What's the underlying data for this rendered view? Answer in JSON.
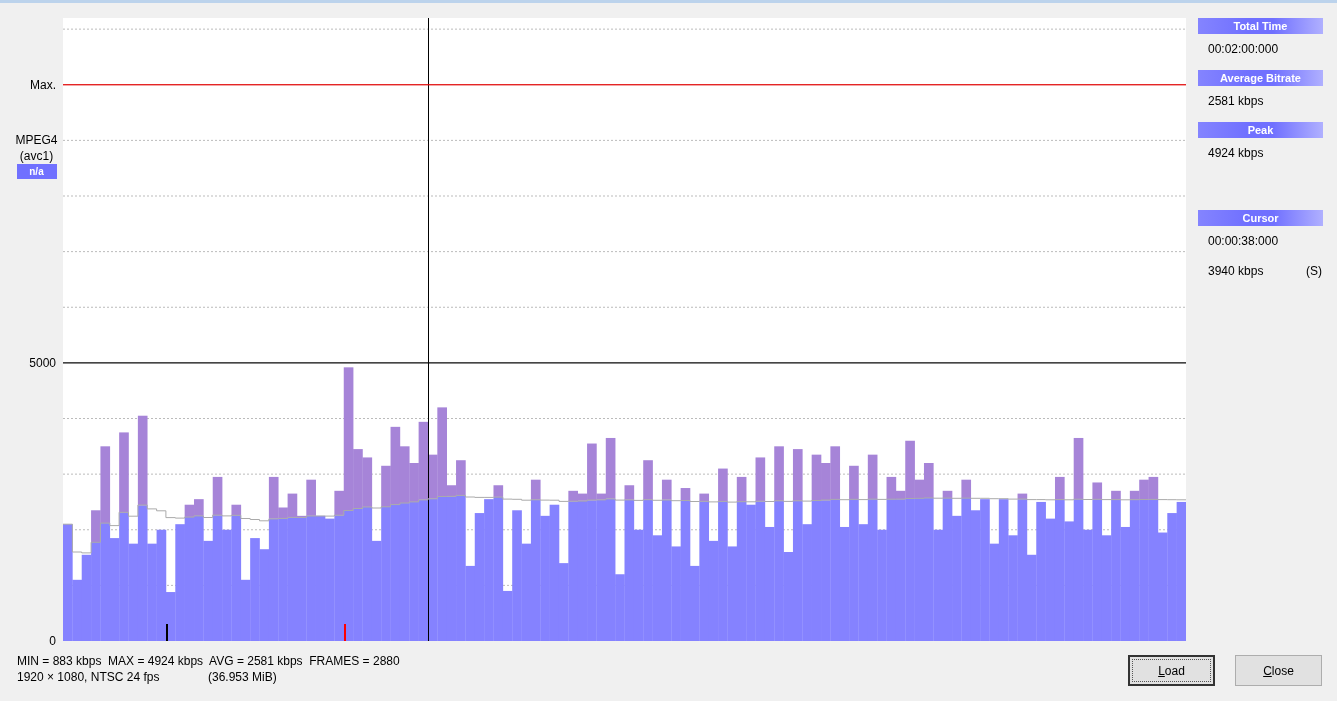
{
  "plot": {
    "codec": "MPEG4",
    "codec_detail": "(avc1)",
    "badge": "n/a",
    "chart_data": {
      "type": "bar",
      "ylim": [
        0,
        11200
      ],
      "yticks": [
        {
          "value": 0,
          "label": "0"
        },
        {
          "value": 5000,
          "label": "5000"
        },
        {
          "value": 10000,
          "label": "Max."
        }
      ],
      "categories": [
        null,
        null,
        null,
        null,
        null,
        null,
        null,
        null,
        null,
        null,
        null,
        null,
        null,
        null,
        null,
        null,
        null,
        null,
        null,
        null,
        null,
        null,
        null,
        null,
        null,
        null,
        null,
        null,
        null,
        null,
        null,
        null,
        null,
        null,
        null,
        null,
        null,
        null,
        null,
        null,
        null,
        null,
        null,
        null,
        null,
        null,
        null,
        null,
        null,
        null,
        null,
        null,
        null,
        null,
        null,
        null,
        null,
        null,
        null,
        null,
        null,
        null,
        null,
        null,
        null,
        null,
        null,
        null,
        null,
        null,
        null,
        null,
        null,
        null,
        null,
        null,
        null,
        null,
        null,
        null,
        null,
        null,
        null,
        null,
        null,
        null,
        null,
        null,
        null,
        null,
        null,
        null,
        null,
        null,
        null,
        null,
        null,
        null,
        null,
        null,
        null,
        null,
        null,
        null,
        null,
        null,
        null,
        null,
        null,
        null,
        null,
        null,
        null,
        null,
        null,
        null,
        null,
        null,
        null,
        null
      ],
      "stacked": true,
      "series": [
        {
          "color": "#8582ff",
          "values": [
            2100,
            1100,
            1550,
            1780,
            2120,
            1850,
            2310,
            1750,
            2440,
            1750,
            2000,
            880,
            2100,
            2230,
            2250,
            1800,
            2260,
            2000,
            2260,
            1100,
            1850,
            1650,
            2200,
            2200,
            2220,
            2220,
            2250,
            2250,
            2200,
            2260,
            2350,
            2380,
            2410,
            1800,
            2410,
            2450,
            2480,
            2500,
            2540,
            2560,
            2600,
            2600,
            2620,
            1350,
            2300,
            2550,
            2590,
            900,
            2350,
            1750,
            2540,
            2250,
            2450,
            1400,
            2510,
            2520,
            2530,
            2540,
            2560,
            1200,
            2540,
            2000,
            2540,
            1900,
            2540,
            1700,
            2530,
            1350,
            2510,
            1800,
            2510,
            1700,
            2500,
            2450,
            2510,
            2050,
            2520,
            1600,
            2520,
            2100,
            2530,
            2530,
            2550,
            2050,
            2550,
            2100,
            2550,
            2000,
            2550,
            2550,
            2560,
            2570,
            2570,
            2000,
            2570,
            2250,
            2570,
            2350,
            2550,
            1750,
            2550,
            1900,
            2550,
            1550,
            2500,
            2200,
            2540,
            2150,
            2550,
            2000,
            2550,
            1900,
            2540,
            2050,
            2540,
            2540,
            2550,
            1950,
            2300,
            2500
          ]
        },
        {
          "color": "#a684d8",
          "values": [
            0,
            0,
            0,
            570,
            1380,
            0,
            1440,
            0,
            1610,
            0,
            0,
            0,
            0,
            220,
            300,
            0,
            690,
            0,
            190,
            0,
            0,
            0,
            750,
            200,
            430,
            30,
            650,
            0,
            0,
            440,
            2570,
            1070,
            890,
            0,
            740,
            1400,
            1020,
            700,
            1400,
            790,
            1600,
            200,
            630,
            0,
            0,
            0,
            210,
            0,
            0,
            0,
            360,
            0,
            0,
            0,
            190,
            130,
            1020,
            110,
            1090,
            0,
            260,
            0,
            710,
            0,
            360,
            0,
            220,
            0,
            140,
            0,
            590,
            0,
            450,
            0,
            790,
            0,
            980,
            0,
            930,
            0,
            820,
            670,
            950,
            0,
            600,
            0,
            800,
            0,
            400,
            150,
            1040,
            330,
            630,
            0,
            130,
            0,
            330,
            0,
            0,
            0,
            0,
            0,
            100,
            0,
            0,
            0,
            410,
            0,
            1100,
            0,
            300,
            0,
            160,
            0,
            160,
            360,
            400,
            0,
            0,
            0
          ]
        }
      ]
    },
    "cursor": {
      "level": 0.325
    },
    "markers": [
      {
        "color": "#000000",
        "level": 0.0917
      },
      {
        "color": "#ff0000",
        "level": 0.25
      }
    ]
  },
  "info_panel": {
    "sections": [
      {
        "header": "Total Time",
        "lines": [
          {
            "text": "00:02:00:000"
          }
        ]
      },
      {
        "header": "Average Bitrate",
        "lines": [
          {
            "text": "2581 kbps"
          }
        ]
      },
      {
        "header": "Peak",
        "lines": [
          {
            "text": "4924 kbps"
          }
        ]
      },
      {
        "header": "Cursor",
        "lines": [
          {
            "text": "00:00:38:000"
          },
          {
            "text": "3940 kbps",
            "note": "(S)"
          }
        ]
      }
    ]
  },
  "stats": {
    "summary": "MIN = 883 kbps  MAX = 4924 kbps  AVG = 2581 kbps  FRAMES = 2880",
    "format": "1920 × 1080, NTSC 24 fps",
    "size": "(36.953 MiB)"
  },
  "buttons": [
    {
      "label": "Load",
      "default": true
    },
    {
      "label": "Close",
      "default": false
    }
  ]
}
